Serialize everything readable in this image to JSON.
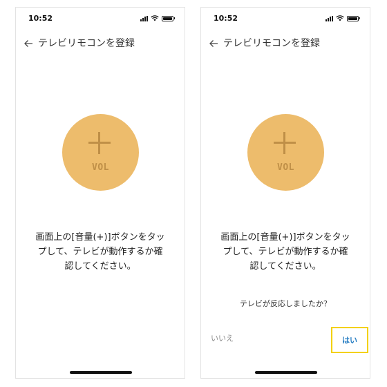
{
  "status_bar": {
    "time": "10:52"
  },
  "nav": {
    "title": "テレビリモコンを登録"
  },
  "remote_button": {
    "symbol": "+",
    "label": "VOL"
  },
  "instruction": {
    "lines": [
      "画面上の[音量(+)]ボタンをタッ",
      "プして、テレビが動作するか確",
      "認してください。"
    ]
  },
  "confirm": {
    "question": "テレビが反応しましたか？",
    "no_label": "いいえ",
    "yes_label": "はい"
  },
  "colors": {
    "button_fill": "#edbc6c",
    "button_ink": "#bf8f47",
    "highlight": "#f3d100",
    "yes_text": "#2a7fc4"
  },
  "icons": {
    "back": "arrow-left-icon",
    "signal": "cellular-signal-icon",
    "wifi": "wifi-icon",
    "battery": "battery-icon"
  }
}
